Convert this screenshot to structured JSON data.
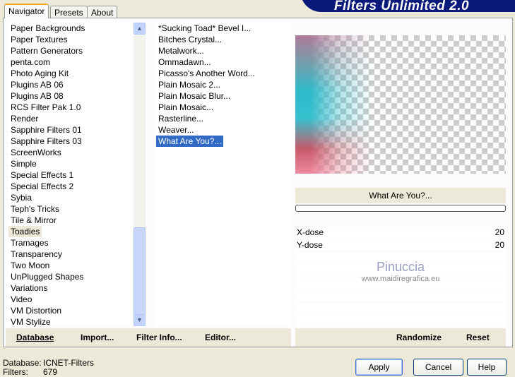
{
  "app": {
    "title": "Filters Unlimited 2.0"
  },
  "tabs": [
    {
      "label": "Navigator"
    },
    {
      "label": "Presets"
    },
    {
      "label": "About"
    }
  ],
  "categories": [
    "Paper Backgrounds",
    "Paper Textures",
    "Pattern Generators",
    "penta.com",
    "Photo Aging Kit",
    "Plugins AB 06",
    "Plugins AB 08",
    "RCS Filter Pak 1.0",
    "Render",
    "Sapphire Filters 01",
    "Sapphire Filters 03",
    "ScreenWorks",
    "Simple",
    "Special Effects 1",
    "Special Effects 2",
    "Sybia",
    "Teph's Tricks",
    "Tile & Mirror",
    "Toadies",
    "Tramages",
    "Transparency",
    "Two Moon",
    "UnPlugged Shapes",
    "Variations",
    "Video",
    "VM Distortion",
    "VM Stylize"
  ],
  "selected_category": "Toadies",
  "filters": [
    "*Sucking Toad*  Bevel I...",
    "Bitches Crystal...",
    "Metalwork...",
    "Ommadawn...",
    "Picasso's Another Word...",
    "Plain Mosaic 2...",
    "Plain Mosaic Blur...",
    "Plain Mosaic...",
    "Rasterline...",
    "Weaver...",
    "What Are You?..."
  ],
  "selected_filter": "What Are You?...",
  "filter_name": "What Are You?...",
  "progress": 0,
  "params": [
    {
      "label": "X-dose",
      "value": "20"
    },
    {
      "label": "Y-dose",
      "value": "20"
    }
  ],
  "watermark": {
    "name": "Pinuccia",
    "url": "www.maidiregrafica.eu"
  },
  "bottom": {
    "database": "Database",
    "import": "Import...",
    "filter_info": "Filter Info...",
    "editor": "Editor...",
    "randomize": "Randomize",
    "reset": "Reset"
  },
  "status": {
    "db_label": "Database:",
    "db_value": "ICNET-Filters",
    "filters_label": "Filters:",
    "filters_value": "679"
  },
  "buttons": {
    "apply": "Apply",
    "cancel": "Cancel",
    "help": "Help"
  },
  "colors": {
    "selection": "#316ac5",
    "banner": "#0a1a7a"
  }
}
